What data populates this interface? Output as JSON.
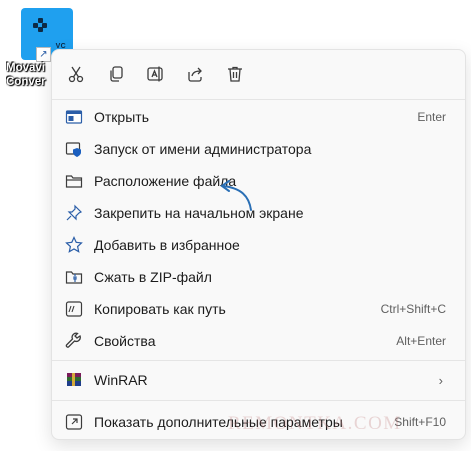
{
  "desktop_shortcut": {
    "label_line1": "Movavi",
    "label_line2": "Conver",
    "tile_text": "VC",
    "overlay": "shortcut-arrow-icon"
  },
  "quick_actions": [
    {
      "name": "cut",
      "icon": "scissors-icon"
    },
    {
      "name": "copy",
      "icon": "copy-icon"
    },
    {
      "name": "rename",
      "icon": "rename-icon"
    },
    {
      "name": "share",
      "icon": "share-icon"
    },
    {
      "name": "delete",
      "icon": "trash-icon"
    }
  ],
  "menu": {
    "items": [
      {
        "label": "Открыть",
        "shortcut": "Enter",
        "icon": "open-window-icon"
      },
      {
        "label": "Запуск от имени администратора",
        "shortcut": "",
        "icon": "shield-icon"
      },
      {
        "label": "Расположение файла",
        "shortcut": "",
        "icon": "folder-icon"
      },
      {
        "label": "Закрепить на начальном экране",
        "shortcut": "",
        "icon": "pin-icon"
      },
      {
        "label": "Добавить в избранное",
        "shortcut": "",
        "icon": "star-icon"
      },
      {
        "label": "Сжать в ZIP-файл",
        "shortcut": "",
        "icon": "zip-folder-icon"
      },
      {
        "label": "Копировать как путь",
        "shortcut": "Ctrl+Shift+C",
        "icon": "copy-path-icon"
      },
      {
        "label": "Свойства",
        "shortcut": "Alt+Enter",
        "icon": "wrench-icon"
      }
    ],
    "winrar": {
      "label": "WinRAR",
      "icon": "winrar-icon",
      "submenu_indicator": "›"
    },
    "more": {
      "label": "Показать дополнительные параметры",
      "shortcut": "Shift+F10",
      "icon": "more-options-icon"
    }
  },
  "watermark": "REMONTKA.COM",
  "colors": {
    "accent": "#1fa0ef",
    "menu_bg": "#f9f9f9",
    "icon_stroke": "#3c3c3c",
    "shield_blue": "#1b5fbf",
    "annotation_arrow": "#2a6fb5"
  }
}
